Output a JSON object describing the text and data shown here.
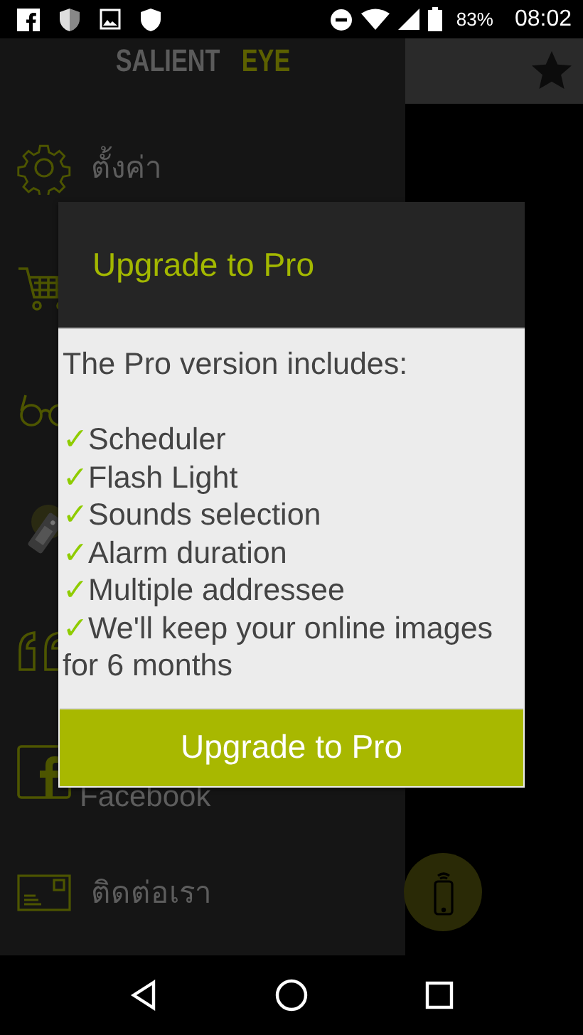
{
  "status_bar": {
    "battery": "83%",
    "time": "08:02"
  },
  "drawer": {
    "logo": [
      "SALIENT",
      "EYE"
    ],
    "items": [
      {
        "kind": "labeled",
        "label": "ตั้งค่า"
      },
      {
        "kind": "bare"
      },
      {
        "kind": "bare"
      },
      {
        "kind": "bare"
      },
      {
        "kind": "bare"
      },
      {
        "kind": "labeled",
        "label": "Facebook"
      },
      {
        "kind": "labeled",
        "label": "ติดต่อเรา"
      }
    ]
  },
  "dialog": {
    "title": "Upgrade to Pro",
    "intro": "The Pro version includes:",
    "features": [
      {
        "mark": "✓",
        "text": "Scheduler"
      },
      {
        "mark": "✓",
        "text": "Flash Light"
      },
      {
        "mark": "✓",
        "text": "Sounds selection"
      },
      {
        "mark": "✓",
        "text": "Alarm duration"
      },
      {
        "mark": "✓",
        "text": "Multiple addressee"
      },
      {
        "mark": "✓",
        "text": "We'll keep your online images for 6 months"
      }
    ],
    "button": "Upgrade to Pro"
  }
}
